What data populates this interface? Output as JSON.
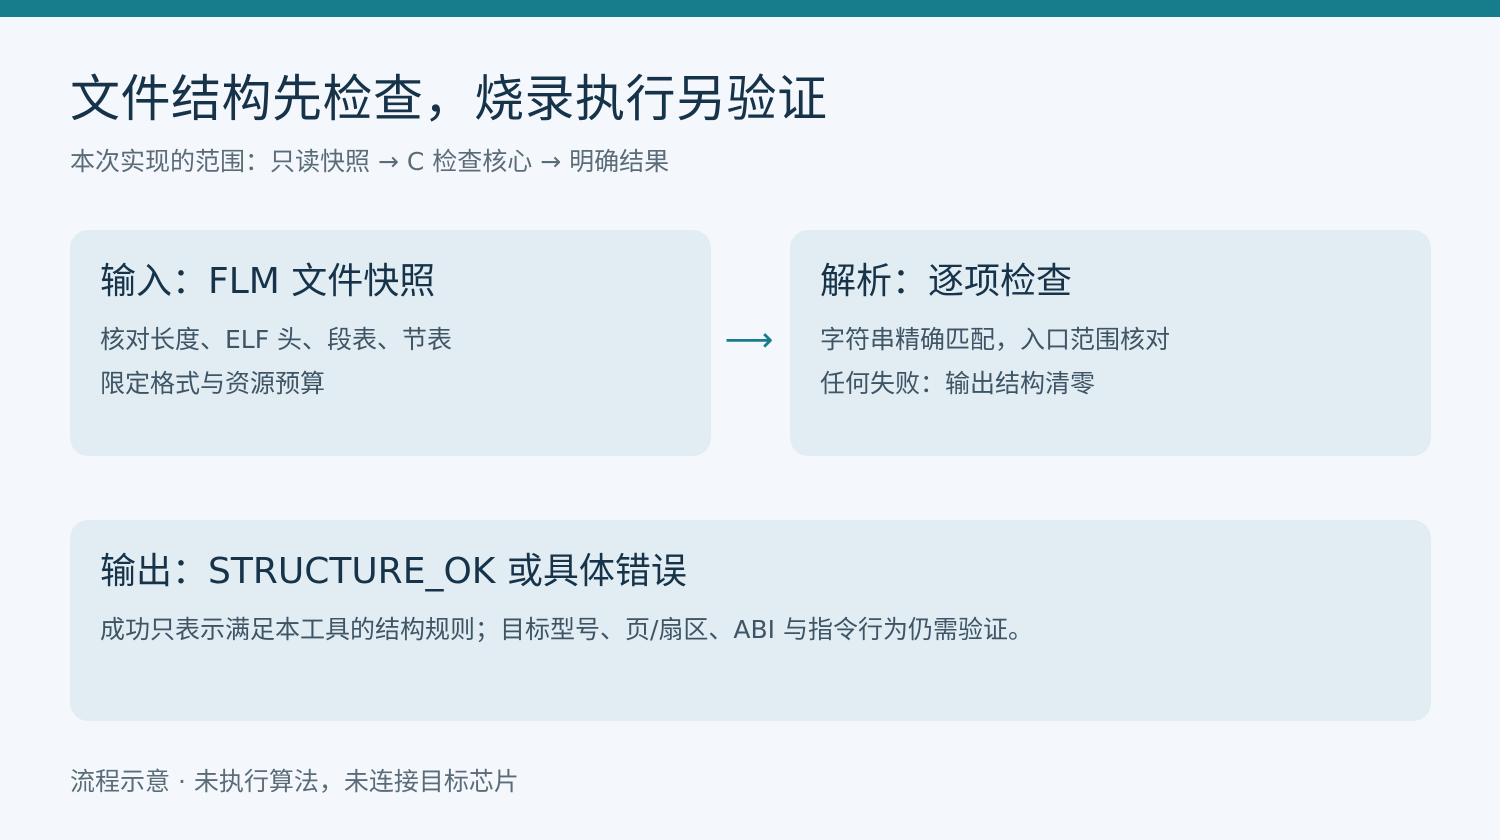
{
  "header": {
    "title": "文件结构先检查，烧录执行另验证",
    "subtitle": "本次实现的范围：只读快照 → C 检查核心 → 明确结果"
  },
  "steps": {
    "input": {
      "heading": "输入：FLM 文件快照",
      "lines": [
        "核对长度、ELF 头、段表、节表",
        "限定格式与资源预算"
      ]
    },
    "arrow": "⟶",
    "parse": {
      "heading": "解析：逐项检查",
      "lines": [
        "字符串精确匹配，入口范围核对",
        "任何失败：输出结构清零"
      ]
    },
    "output": {
      "heading": "输出：STRUCTURE_OK 或具体错误",
      "lines": [
        "成功只表示满足本工具的结构规则；目标型号、页/扇区、ABI 与指令行为仍需验证。"
      ]
    }
  },
  "footer": {
    "note": "流程示意 · 未执行算法，未连接目标芯片"
  },
  "colors": {
    "accent": "#177c8c",
    "background": "#f4f8fc",
    "card": "#e1edf3",
    "text": "#16334a",
    "muted": "#5b6c79"
  }
}
